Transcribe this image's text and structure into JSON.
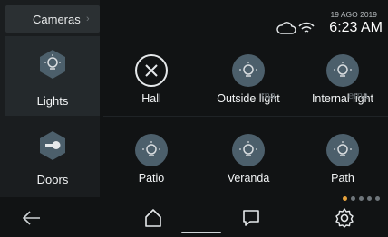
{
  "sidebar": {
    "tab_label": "Cameras",
    "tab_chevron": "›",
    "items": [
      {
        "label": "Lights",
        "icon": "bulb-icon",
        "active": true
      },
      {
        "label": "Doors",
        "icon": "door-lock-icon",
        "active": false
      }
    ]
  },
  "status": {
    "date": "19 AGO 2019",
    "time": "6:23 AM",
    "icons": [
      "cloud-icon",
      "wifi-icon"
    ]
  },
  "tiles": [
    {
      "label": "Hall",
      "state": "off"
    },
    {
      "label": "Outside light",
      "state": "light"
    },
    {
      "label": "Internal light",
      "state": "light"
    },
    {
      "label": "Patio",
      "state": "light"
    },
    {
      "label": "Veranda",
      "state": "light"
    },
    {
      "label": "Path",
      "state": "light"
    }
  ],
  "ghost_text": [
    "rna",
    "erna"
  ],
  "pager": {
    "total": 5,
    "active_index": 0,
    "active_color": "#e6a23c"
  },
  "bottom_nav": [
    "back-arrow-icon",
    "home-icon",
    "message-icon",
    "settings-icon"
  ],
  "colors": {
    "background": "#111314",
    "sidebar": "#1a1d1f",
    "tile_circle": "#4c5f6b"
  }
}
